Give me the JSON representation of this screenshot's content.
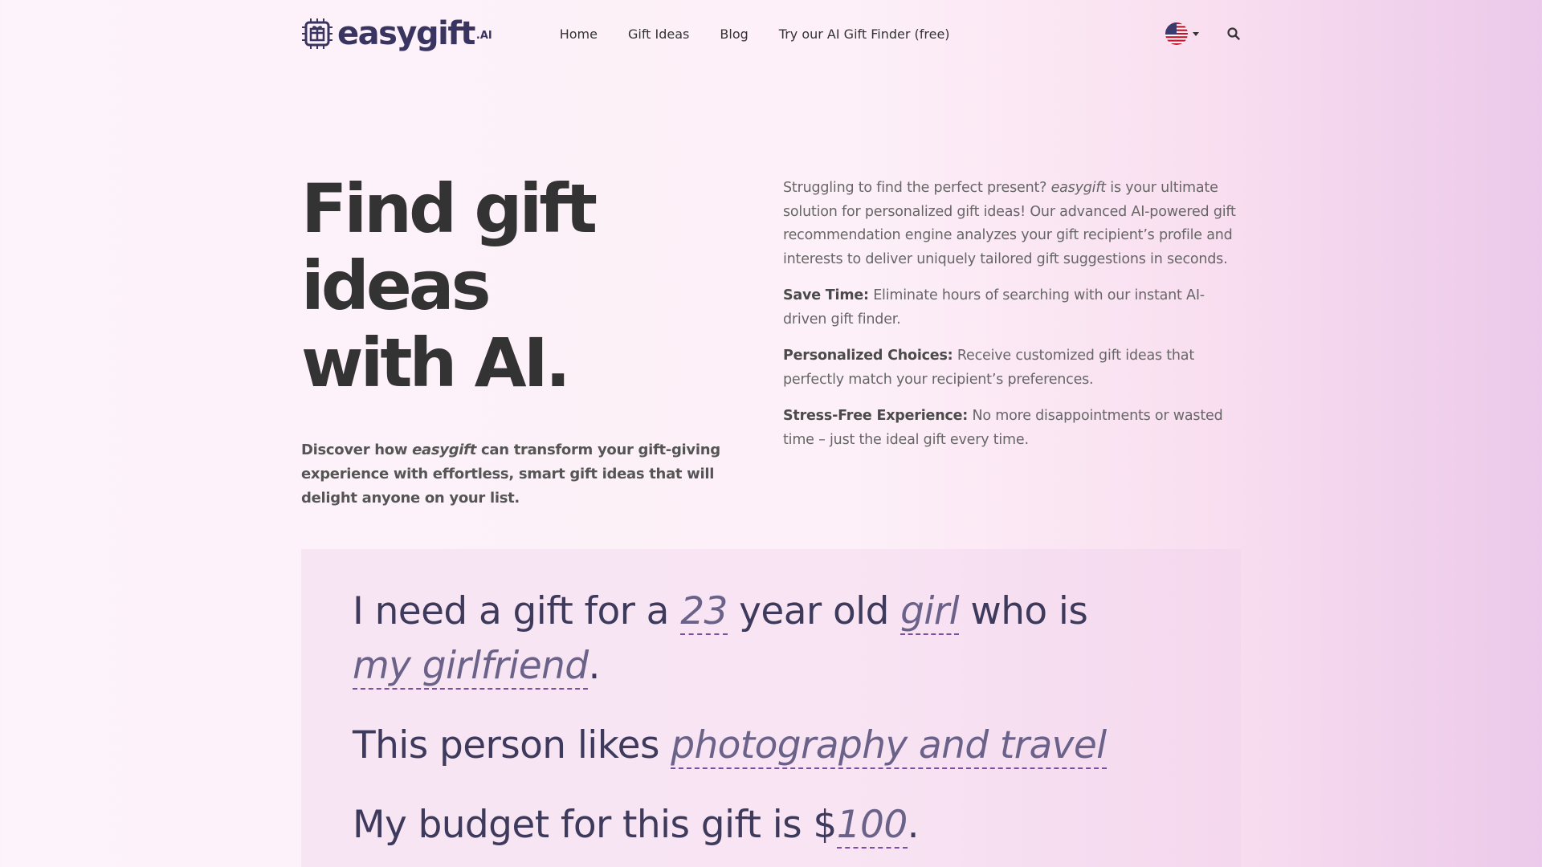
{
  "brand": {
    "logo_text": "easygift",
    "logo_suffix": ".AI"
  },
  "nav": {
    "items": [
      "Home",
      "Gift Ideas",
      "Blog",
      "Try our AI Gift Finder (free)"
    ],
    "language_flag": "us-flag-icon",
    "search_icon": "search-icon"
  },
  "hero": {
    "title_line1": "Find gift ideas",
    "title_line2": "with AI.",
    "sub_prefix": "Discover how ",
    "sub_brand": "easygift",
    "sub_suffix": " can transform your gift-giving experience with effortless, smart gift ideas that will delight anyone on your list.",
    "intro_prefix": "Struggling to find the perfect present? ",
    "intro_brand": "easygift",
    "intro_suffix": " is your ultimate solution for personalized gift ideas! Our advanced AI-powered gift recommendation engine analyzes your gift recipient’s profile and interests to deliver uniquely tailored gift suggestions in seconds.",
    "features": [
      {
        "title": "Save Time:",
        "text": " Eliminate hours of searching with our instant AI-driven gift finder."
      },
      {
        "title": "Personalized Choices:",
        "text": " Receive customized gift ideas that perfectly match your recipient’s preferences."
      },
      {
        "title": "Stress-Free Experience:",
        "text": " No more disappointments or wasted time – just the ideal gift every time."
      }
    ]
  },
  "finder": {
    "s1_a": "I need a gift for a ",
    "age": "23",
    "s1_b": " year old ",
    "gender": "girl",
    "s1_c": " who is",
    "relation": "my girlfriend",
    "s1_end": ".",
    "s2_a": "This person likes ",
    "interests": "photography and travel",
    "s3_a": "My budget for this gift is $",
    "budget": "100",
    "s3_end": "."
  },
  "colors": {
    "accent": "#3a3560",
    "fill_underline": "#7a4fa0",
    "text": "#333333"
  }
}
